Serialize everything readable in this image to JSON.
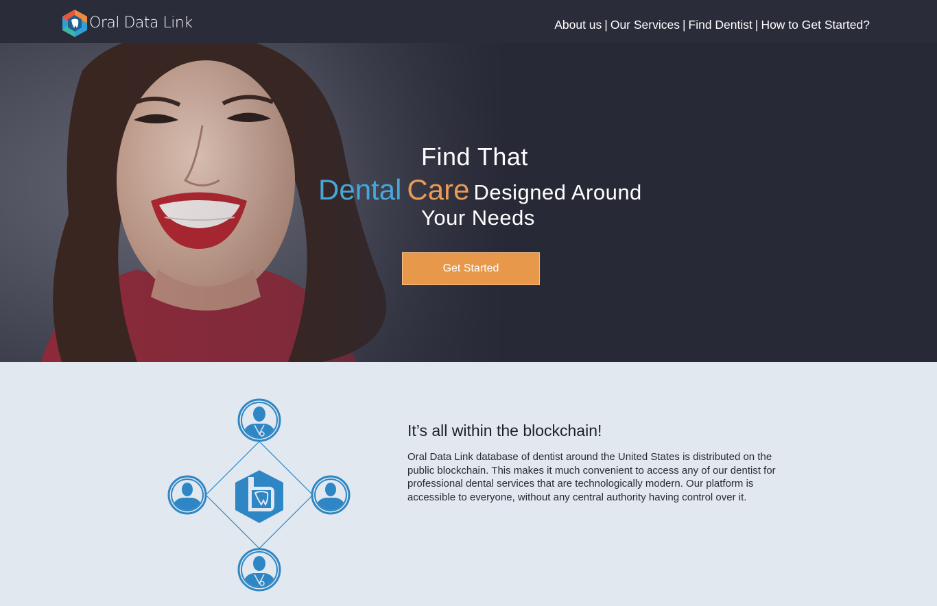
{
  "header": {
    "logo_text": "Oral Data Link",
    "nav": [
      {
        "label": "About us"
      },
      {
        "label": "Our Services"
      },
      {
        "label": "Find Dentist"
      },
      {
        "label": "How to Get Started?"
      }
    ],
    "separator": "|"
  },
  "hero": {
    "line1": "Find That",
    "word_dental": "Dental",
    "word_care": "Care",
    "line2_rest": "Designed Around",
    "line3": "Your Needs",
    "cta_label": "Get Started"
  },
  "blockchain": {
    "title": "It’s all within the blockchain!",
    "body": "Oral Data Link database of dentist around the United States is distributed on the public blockchain. This makes it much convenient to access any of our dentist for professional dental services that are technologically modern. Our platform is accessible to everyone, without any central authority having control over it."
  },
  "icons": {
    "logo": "hexagon-tooth-logo-icon",
    "hero_image": "smiling-woman-photo",
    "diagram_center": "hexagon-b-tooth-icon",
    "diagram_nodes": [
      "doctor-icon",
      "user-icon",
      "user-icon",
      "doctor-icon"
    ]
  },
  "colors": {
    "header_bg": "#2a2c3a",
    "hero_bg": "#282937",
    "accent_blue": "#45a8d9",
    "accent_orange": "#eb9a54",
    "cta_bg": "#e8984a",
    "section_bg": "#e1e8f0",
    "diagram_blue": "#2f86c4"
  }
}
